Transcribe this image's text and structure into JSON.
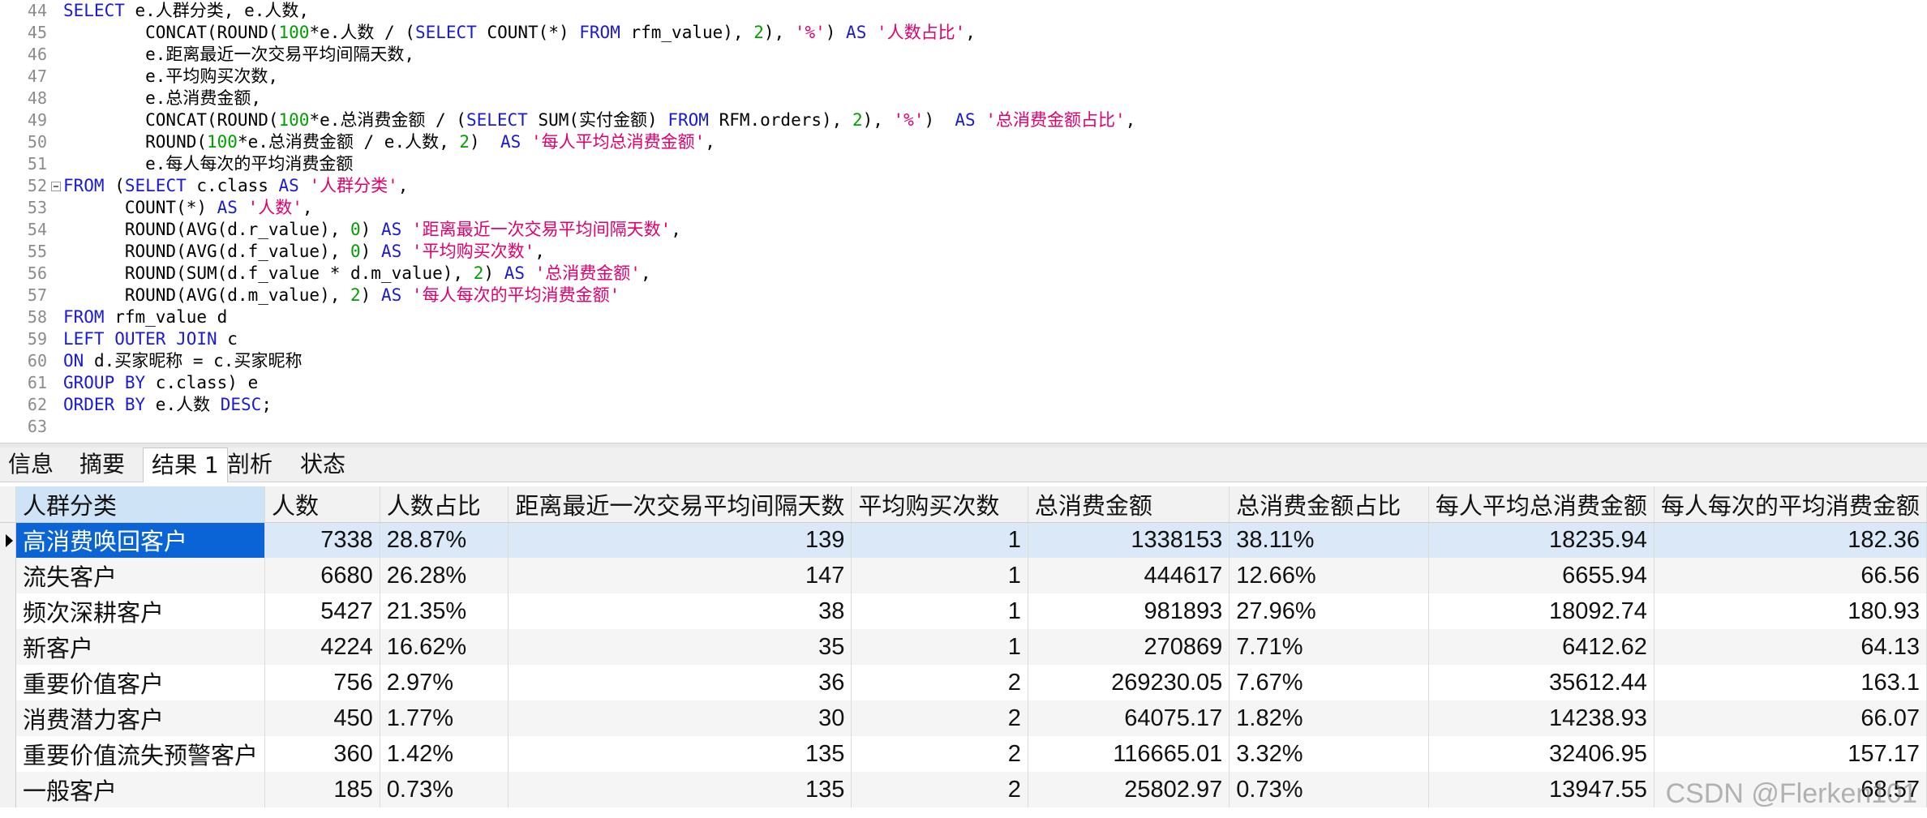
{
  "editor": {
    "lines": [
      {
        "n": "44",
        "parts": [
          [
            "kw",
            "SELECT"
          ],
          [
            "fn",
            " e.人群分类, e.人数,"
          ]
        ]
      },
      {
        "n": "45",
        "parts": [
          [
            "fn",
            "        CONCAT(ROUND("
          ],
          [
            "num",
            "100"
          ],
          [
            "fn",
            "*e.人数 / ("
          ],
          [
            "kw",
            "SELECT"
          ],
          [
            "fn",
            " COUNT(*) "
          ],
          [
            "kw",
            "FROM"
          ],
          [
            "fn",
            " rfm_value), "
          ],
          [
            "num",
            "2"
          ],
          [
            "fn",
            "), "
          ],
          [
            "str",
            "'%'"
          ],
          [
            "fn",
            ") "
          ],
          [
            "kw",
            "AS"
          ],
          [
            "fn",
            " "
          ],
          [
            "str",
            "'人数占比'"
          ],
          [
            "fn",
            ","
          ]
        ]
      },
      {
        "n": "46",
        "parts": [
          [
            "fn",
            "        e.距离最近一次交易平均间隔天数,"
          ]
        ]
      },
      {
        "n": "47",
        "parts": [
          [
            "fn",
            "        e.平均购买次数,"
          ]
        ]
      },
      {
        "n": "48",
        "parts": [
          [
            "fn",
            "        e.总消费金额,"
          ]
        ]
      },
      {
        "n": "49",
        "parts": [
          [
            "fn",
            "        CONCAT(ROUND("
          ],
          [
            "num",
            "100"
          ],
          [
            "fn",
            "*e.总消费金额 / ("
          ],
          [
            "kw",
            "SELECT"
          ],
          [
            "fn",
            " SUM(实付金额) "
          ],
          [
            "kw",
            "FROM"
          ],
          [
            "fn",
            " RFM.orders), "
          ],
          [
            "num",
            "2"
          ],
          [
            "fn",
            "), "
          ],
          [
            "str",
            "'%'"
          ],
          [
            "fn",
            ")  "
          ],
          [
            "kw",
            "AS"
          ],
          [
            "fn",
            " "
          ],
          [
            "str",
            "'总消费金额占比'"
          ],
          [
            "fn",
            ","
          ]
        ]
      },
      {
        "n": "50",
        "parts": [
          [
            "fn",
            "        ROUND("
          ],
          [
            "num",
            "100"
          ],
          [
            "fn",
            "*e.总消费金额 / e.人数, "
          ],
          [
            "num",
            "2"
          ],
          [
            "fn",
            ")  "
          ],
          [
            "kw",
            "AS"
          ],
          [
            "fn",
            " "
          ],
          [
            "str",
            "'每人平均总消费金额'"
          ],
          [
            "fn",
            ","
          ]
        ]
      },
      {
        "n": "51",
        "parts": [
          [
            "fn",
            "        e.每人每次的平均消费金额"
          ]
        ]
      },
      {
        "n": "52",
        "fold": true,
        "parts": [
          [
            "kw",
            "FROM"
          ],
          [
            "fn",
            " ("
          ],
          [
            "kw",
            "SELECT"
          ],
          [
            "fn",
            " c.class "
          ],
          [
            "kw",
            "AS"
          ],
          [
            "fn",
            " "
          ],
          [
            "str",
            "'人群分类'"
          ],
          [
            "fn",
            ","
          ]
        ]
      },
      {
        "n": "53",
        "parts": [
          [
            "fn",
            "      COUNT(*) "
          ],
          [
            "kw",
            "AS"
          ],
          [
            "fn",
            " "
          ],
          [
            "str",
            "'人数'"
          ],
          [
            "fn",
            ","
          ]
        ]
      },
      {
        "n": "54",
        "parts": [
          [
            "fn",
            "      ROUND(AVG(d.r_value), "
          ],
          [
            "num",
            "0"
          ],
          [
            "fn",
            ") "
          ],
          [
            "kw",
            "AS"
          ],
          [
            "fn",
            " "
          ],
          [
            "str",
            "'距离最近一次交易平均间隔天数'"
          ],
          [
            "fn",
            ","
          ]
        ]
      },
      {
        "n": "55",
        "parts": [
          [
            "fn",
            "      ROUND(AVG(d.f_value), "
          ],
          [
            "num",
            "0"
          ],
          [
            "fn",
            ") "
          ],
          [
            "kw",
            "AS"
          ],
          [
            "fn",
            " "
          ],
          [
            "str",
            "'平均购买次数'"
          ],
          [
            "fn",
            ","
          ]
        ]
      },
      {
        "n": "56",
        "parts": [
          [
            "fn",
            "      ROUND(SUM(d.f_value * d.m_value), "
          ],
          [
            "num",
            "2"
          ],
          [
            "fn",
            ") "
          ],
          [
            "kw",
            "AS"
          ],
          [
            "fn",
            " "
          ],
          [
            "str",
            "'总消费金额'"
          ],
          [
            "fn",
            ","
          ]
        ]
      },
      {
        "n": "57",
        "parts": [
          [
            "fn",
            "      ROUND(AVG(d.m_value), "
          ],
          [
            "num",
            "2"
          ],
          [
            "fn",
            ") "
          ],
          [
            "kw",
            "AS"
          ],
          [
            "fn",
            " "
          ],
          [
            "str",
            "'每人每次的平均消费金额'"
          ]
        ]
      },
      {
        "n": "58",
        "parts": [
          [
            "kw",
            "FROM"
          ],
          [
            "fn",
            " rfm_value d"
          ]
        ]
      },
      {
        "n": "59",
        "parts": [
          [
            "kw",
            "LEFT OUTER JOIN"
          ],
          [
            "fn",
            " c"
          ]
        ]
      },
      {
        "n": "60",
        "parts": [
          [
            "kw",
            "ON"
          ],
          [
            "fn",
            " d.买家昵称 = c.买家昵称"
          ]
        ]
      },
      {
        "n": "61",
        "parts": [
          [
            "kw",
            "GROUP BY"
          ],
          [
            "fn",
            " c.class) e"
          ]
        ]
      },
      {
        "n": "62",
        "parts": [
          [
            "kw",
            "ORDER BY"
          ],
          [
            "fn",
            " e.人数 "
          ],
          [
            "kw",
            "DESC"
          ],
          [
            "fn",
            ";"
          ]
        ]
      },
      {
        "n": "63",
        "parts": []
      }
    ]
  },
  "tabs": {
    "info": "信息",
    "summary": "摘要",
    "result1": "结果 1",
    "profile": "剖析",
    "status": "状态"
  },
  "grid": {
    "columns": [
      "人群分类",
      "人数",
      "人数占比",
      "距离最近一次交易平均间隔天数",
      "平均购买次数",
      "总消费金额",
      "总消费金额占比",
      "每人平均总消费金额",
      "每人每次的平均消费金额"
    ],
    "rows": [
      [
        "高消费唤回客户",
        "7338",
        "28.87%",
        "139",
        "1",
        "1338153",
        "38.11%",
        "18235.94",
        "182.36"
      ],
      [
        "流失客户",
        "6680",
        "26.28%",
        "147",
        "1",
        "444617",
        "12.66%",
        "6655.94",
        "66.56"
      ],
      [
        "频次深耕客户",
        "5427",
        "21.35%",
        "38",
        "1",
        "981893",
        "27.96%",
        "18092.74",
        "180.93"
      ],
      [
        "新客户",
        "4224",
        "16.62%",
        "35",
        "1",
        "270869",
        "7.71%",
        "6412.62",
        "64.13"
      ],
      [
        "重要价值客户",
        "756",
        "2.97%",
        "36",
        "2",
        "269230.05",
        "7.67%",
        "35612.44",
        "163.1"
      ],
      [
        "消费潜力客户",
        "450",
        "1.77%",
        "30",
        "2",
        "64075.17",
        "1.82%",
        "14238.93",
        "66.07"
      ],
      [
        "重要价值流失预警客户",
        "360",
        "1.42%",
        "135",
        "2",
        "116665.01",
        "3.32%",
        "32406.95",
        "157.17"
      ],
      [
        "一般客户",
        "185",
        "0.73%",
        "135",
        "2",
        "25802.97",
        "0.73%",
        "13947.55",
        "68.57"
      ]
    ]
  },
  "watermark": "CSDN @Flerken101",
  "colors": {
    "keyword": "#1a1ad6",
    "number": "#00a000",
    "string": "#e0006e",
    "selection": "#0a64d6"
  }
}
